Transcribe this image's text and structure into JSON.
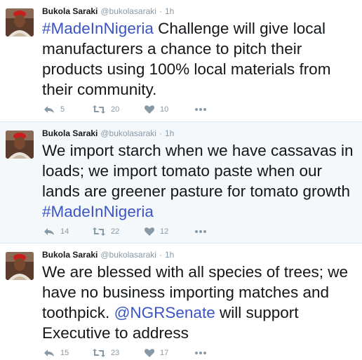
{
  "tweets": [
    {
      "name": "Bukola Saraki",
      "handle": "@bukolasaraki",
      "sep": "·",
      "time": "1h",
      "body": [
        {
          "text": "#MadeInNigeria",
          "link": true
        },
        {
          "text": " Challenge will give local manufacturers a chance to pitch their products using 100% local materials from their community.",
          "link": false
        }
      ],
      "replies": "5",
      "retweets": "20",
      "likes": "10"
    },
    {
      "name": "Bukola Saraki",
      "handle": "@bukolasaraki",
      "sep": "·",
      "time": "1h",
      "body": [
        {
          "text": "We import starch when we have cassavas in loads; we import tomato paste when our lands are greener pasture for tomato growth ",
          "link": false
        },
        {
          "text": "#MadeInNigeria",
          "link": true
        }
      ],
      "replies": "14",
      "retweets": "22",
      "likes": "12"
    },
    {
      "name": "Bukola Saraki",
      "handle": "@bukolasaraki",
      "sep": "·",
      "time": "1h",
      "body": [
        {
          "text": "We are blessed with all species of trees; we have no business importing matches and toothpick. ",
          "link": false
        },
        {
          "text": "@NGRSenate",
          "link": true
        },
        {
          "text": " will support Executive to address",
          "link": false
        }
      ],
      "replies": "15",
      "retweets": "23",
      "likes": "17"
    }
  ],
  "colors": {
    "link": "#3b55c4",
    "text": "#14171a",
    "muted": "#8899a6",
    "highlight_bg": "#f5f8fa"
  },
  "icons": {
    "reply": "reply-icon",
    "retweet": "retweet-icon",
    "like": "heart-icon",
    "more": "more-dots-icon"
  }
}
